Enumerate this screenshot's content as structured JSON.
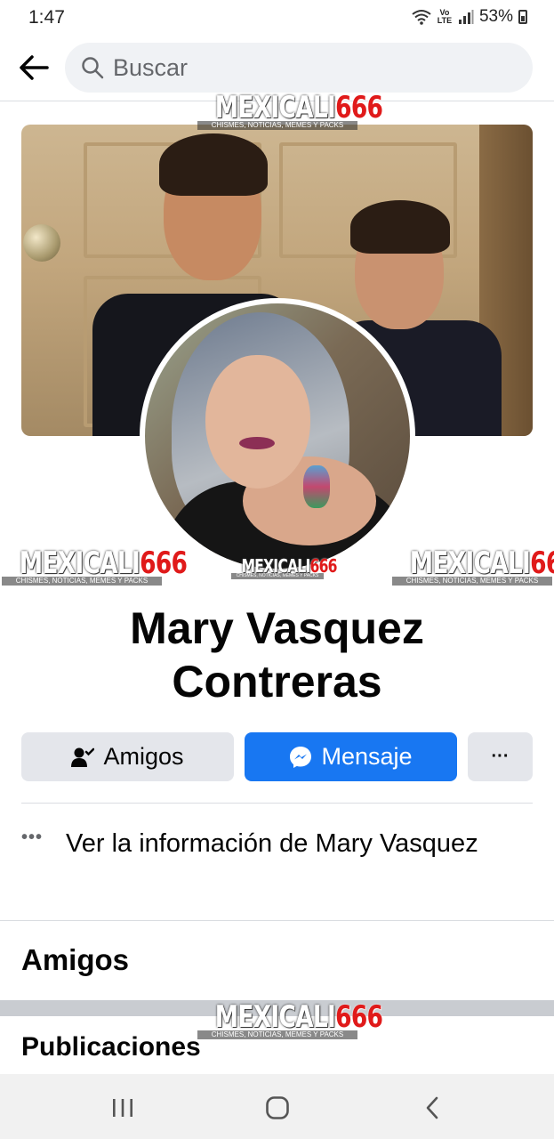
{
  "status_bar": {
    "time": "1:47",
    "battery": "53%",
    "lte_label": "Vo LTE",
    "icons": [
      "wifi-icon",
      "lte-icon",
      "signal-icon",
      "battery-icon"
    ]
  },
  "header": {
    "back_icon": "back-arrow-icon",
    "search_icon": "search-icon",
    "search_placeholder": "Buscar"
  },
  "watermark": {
    "brand_white": "MEXICALI",
    "brand_red": "666",
    "tagline": "CHISMES, NOTICIAS, MEMES Y PACKS"
  },
  "profile": {
    "name_line1": "Mary Vasquez",
    "name_line2": "Contreras"
  },
  "actions": {
    "friends_label": "Amigos",
    "friends_icon": "friend-check-icon",
    "message_label": "Mensaje",
    "message_icon": "messenger-icon",
    "more_label": "···"
  },
  "info": {
    "dots": "•••",
    "text": "Ver la información de Mary Vasquez"
  },
  "sections": {
    "friends_title": "Amigos",
    "posts_title": "Publicaciones"
  },
  "nav": {
    "items": [
      "recent-apps-icon",
      "home-icon",
      "back-icon"
    ]
  },
  "colors": {
    "accent": "#1877f2",
    "button_gray": "#e4e6eb",
    "watermark_red": "#e01a1a"
  }
}
